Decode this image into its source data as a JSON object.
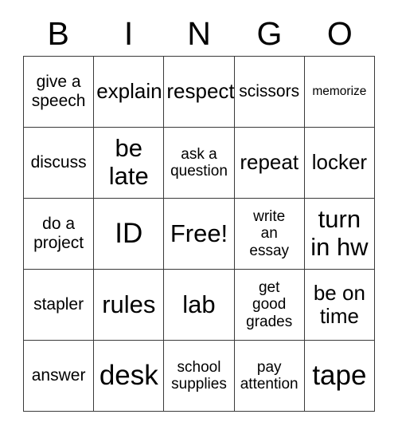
{
  "card": {
    "title_letters": [
      "B",
      "I",
      "N",
      "G",
      "O"
    ],
    "free_space_index": 12,
    "colors": {
      "background": "#ffffff",
      "text": "#000000",
      "grid_line": "#3a3a3a"
    },
    "rows": [
      [
        {
          "text": "give a\nspeech",
          "size": "m"
        },
        {
          "text": "explain",
          "size": "l"
        },
        {
          "text": "respect",
          "size": "l"
        },
        {
          "text": "scissors",
          "size": "m"
        },
        {
          "text": "memorize",
          "size": "xs"
        }
      ],
      [
        {
          "text": "discuss",
          "size": "m"
        },
        {
          "text": "be\nlate",
          "size": "xl"
        },
        {
          "text": "ask a\nquestion",
          "size": "s"
        },
        {
          "text": "repeat",
          "size": "l"
        },
        {
          "text": "locker",
          "size": "l"
        }
      ],
      [
        {
          "text": "do a\nproject",
          "size": "m"
        },
        {
          "text": "ID",
          "size": "xxl"
        },
        {
          "text": "Free!",
          "size": "xl"
        },
        {
          "text": "write\nan\nessay",
          "size": "s"
        },
        {
          "text": "turn\nin hw",
          "size": "xl"
        }
      ],
      [
        {
          "text": "stapler",
          "size": "m"
        },
        {
          "text": "rules",
          "size": "xl"
        },
        {
          "text": "lab",
          "size": "xl"
        },
        {
          "text": "get\ngood\ngrades",
          "size": "s"
        },
        {
          "text": "be on\ntime",
          "size": "l"
        }
      ],
      [
        {
          "text": "answer",
          "size": "m"
        },
        {
          "text": "desk",
          "size": "xxl"
        },
        {
          "text": "school\nsupplies",
          "size": "s"
        },
        {
          "text": "pay\nattention",
          "size": "s"
        },
        {
          "text": "tape",
          "size": "xxl"
        }
      ]
    ]
  }
}
